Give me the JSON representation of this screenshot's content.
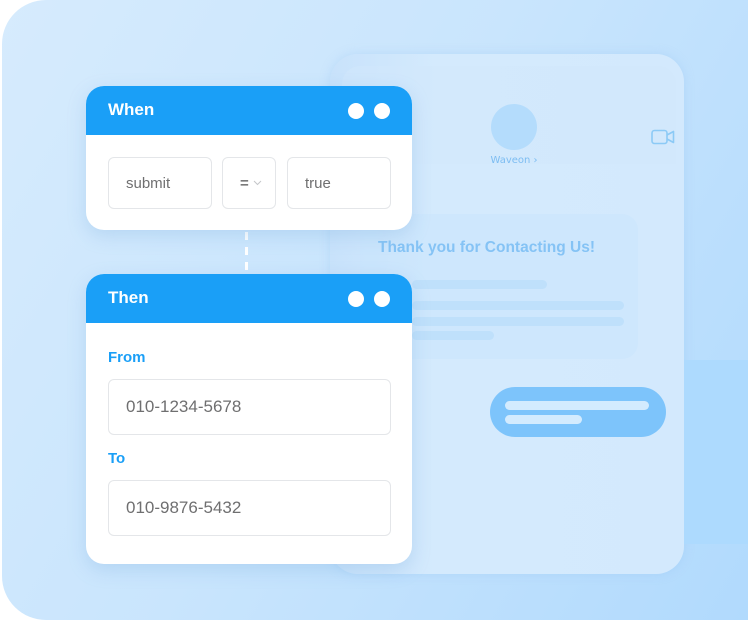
{
  "background": {
    "accent_color": "#1a9ff7"
  },
  "when_card": {
    "title": "When",
    "condition": {
      "field": "submit",
      "operator": "=",
      "value": "true"
    }
  },
  "then_card": {
    "title": "Then",
    "from_label": "From",
    "from_value": "010-1234-5678",
    "to_label": "To",
    "to_value": "010-9876-5432"
  },
  "phone": {
    "contact_name": "Waveon ›",
    "message_title": "Thank you for Contacting Us!",
    "icons": {
      "video": "video-camera-icon",
      "dropdown": "chevron-down-icon"
    }
  }
}
